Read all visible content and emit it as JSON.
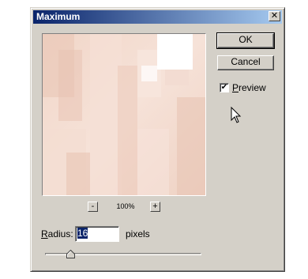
{
  "dialog": {
    "title": "Maximum",
    "close_label": "✕"
  },
  "buttons": {
    "ok_label": "OK",
    "cancel_label": "Cancel"
  },
  "preview": {
    "checked": true,
    "label_accel": "P",
    "label_rest": "review"
  },
  "zoom": {
    "minus_label": "-",
    "plus_label": "+",
    "level": "100%"
  },
  "radius": {
    "label_accel": "R",
    "label_rest": "adius:",
    "value": "16",
    "unit": "pixels",
    "slider_fraction": 0.16
  }
}
